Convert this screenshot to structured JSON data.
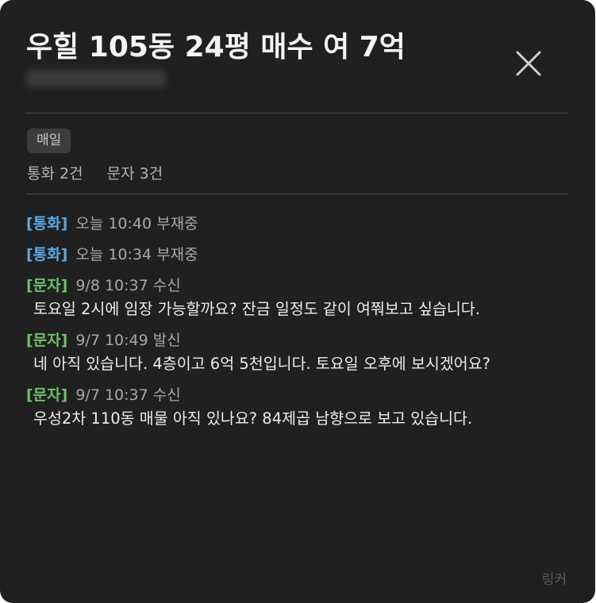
{
  "modal": {
    "title": "우힐 105동 24평 매수 여 7억",
    "tag": "매일",
    "counts": {
      "calls": "통화 2건",
      "messages": "문자 3건"
    },
    "brand": "링커"
  },
  "log": [
    {
      "type": "call",
      "badge": "[통화]",
      "meta": "오늘 10:40 부재중",
      "text": ""
    },
    {
      "type": "call",
      "badge": "[통화]",
      "meta": "오늘 10:34 부재중",
      "text": ""
    },
    {
      "type": "sms",
      "badge": "[문자]",
      "meta": "9/8 10:37 수신",
      "text": "토요일 2시에 임장 가능할까요? 잔금 일정도 같이 여쭤보고 싶습니다."
    },
    {
      "type": "sms",
      "badge": "[문자]",
      "meta": "9/7 10:49 발신",
      "text": "네 아직 있습니다. 4층이고 6억 5천입니다. 토요일 오후에 보시겠어요?"
    },
    {
      "type": "sms",
      "badge": "[문자]",
      "meta": "9/7 10:37 수신",
      "text": "우성2차 110동 매물 아직 있나요? 84제곱 남향으로 보고 있습니다."
    }
  ],
  "colors": {
    "background": "#202020",
    "call_badge": "#5aa9e6",
    "sms_badge": "#6cc06a"
  },
  "icons": {
    "close": "close-icon"
  }
}
